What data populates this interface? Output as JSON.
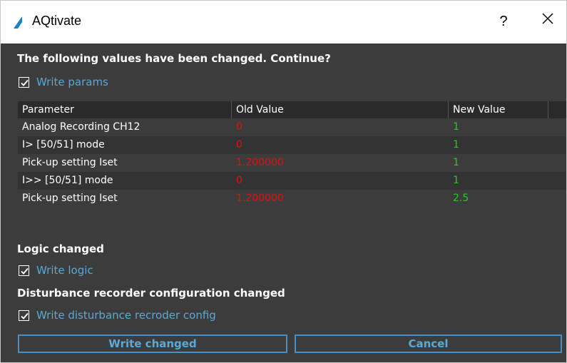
{
  "window": {
    "title": "AQtivate",
    "help_label": "?",
    "close_icon": "close-icon"
  },
  "params_section": {
    "heading": "The following values have been changed. Continue?",
    "checkbox_label": "Write params",
    "checked": true
  },
  "table": {
    "headers": [
      "Parameter",
      "Old Value",
      "New Value"
    ],
    "rows": [
      {
        "parameter": "Analog Recording CH12",
        "old": "0",
        "new": "1"
      },
      {
        "parameter": "I> [50/51] mode",
        "old": "0",
        "new": "1"
      },
      {
        "parameter": "Pick-up setting Iset",
        "old": "1.200000",
        "new": "1"
      },
      {
        "parameter": "I>> [50/51] mode",
        "old": "0",
        "new": "1"
      },
      {
        "parameter": "Pick-up setting Iset",
        "old": "1.200000",
        "new": "2.5"
      }
    ]
  },
  "logic_section": {
    "heading": "Logic changed",
    "checkbox_label": "Write logic",
    "checked": true
  },
  "dr_section": {
    "heading": "Disturbance recorder configuration changed",
    "checkbox_label": "Write disturbance recroder config",
    "checked": true
  },
  "buttons": {
    "write": "Write changed",
    "cancel": "Cancel"
  },
  "colors": {
    "accent": "#5aa9d6",
    "old_value": "#e01010",
    "new_value": "#22cc22",
    "background": "#3c3c3c"
  }
}
